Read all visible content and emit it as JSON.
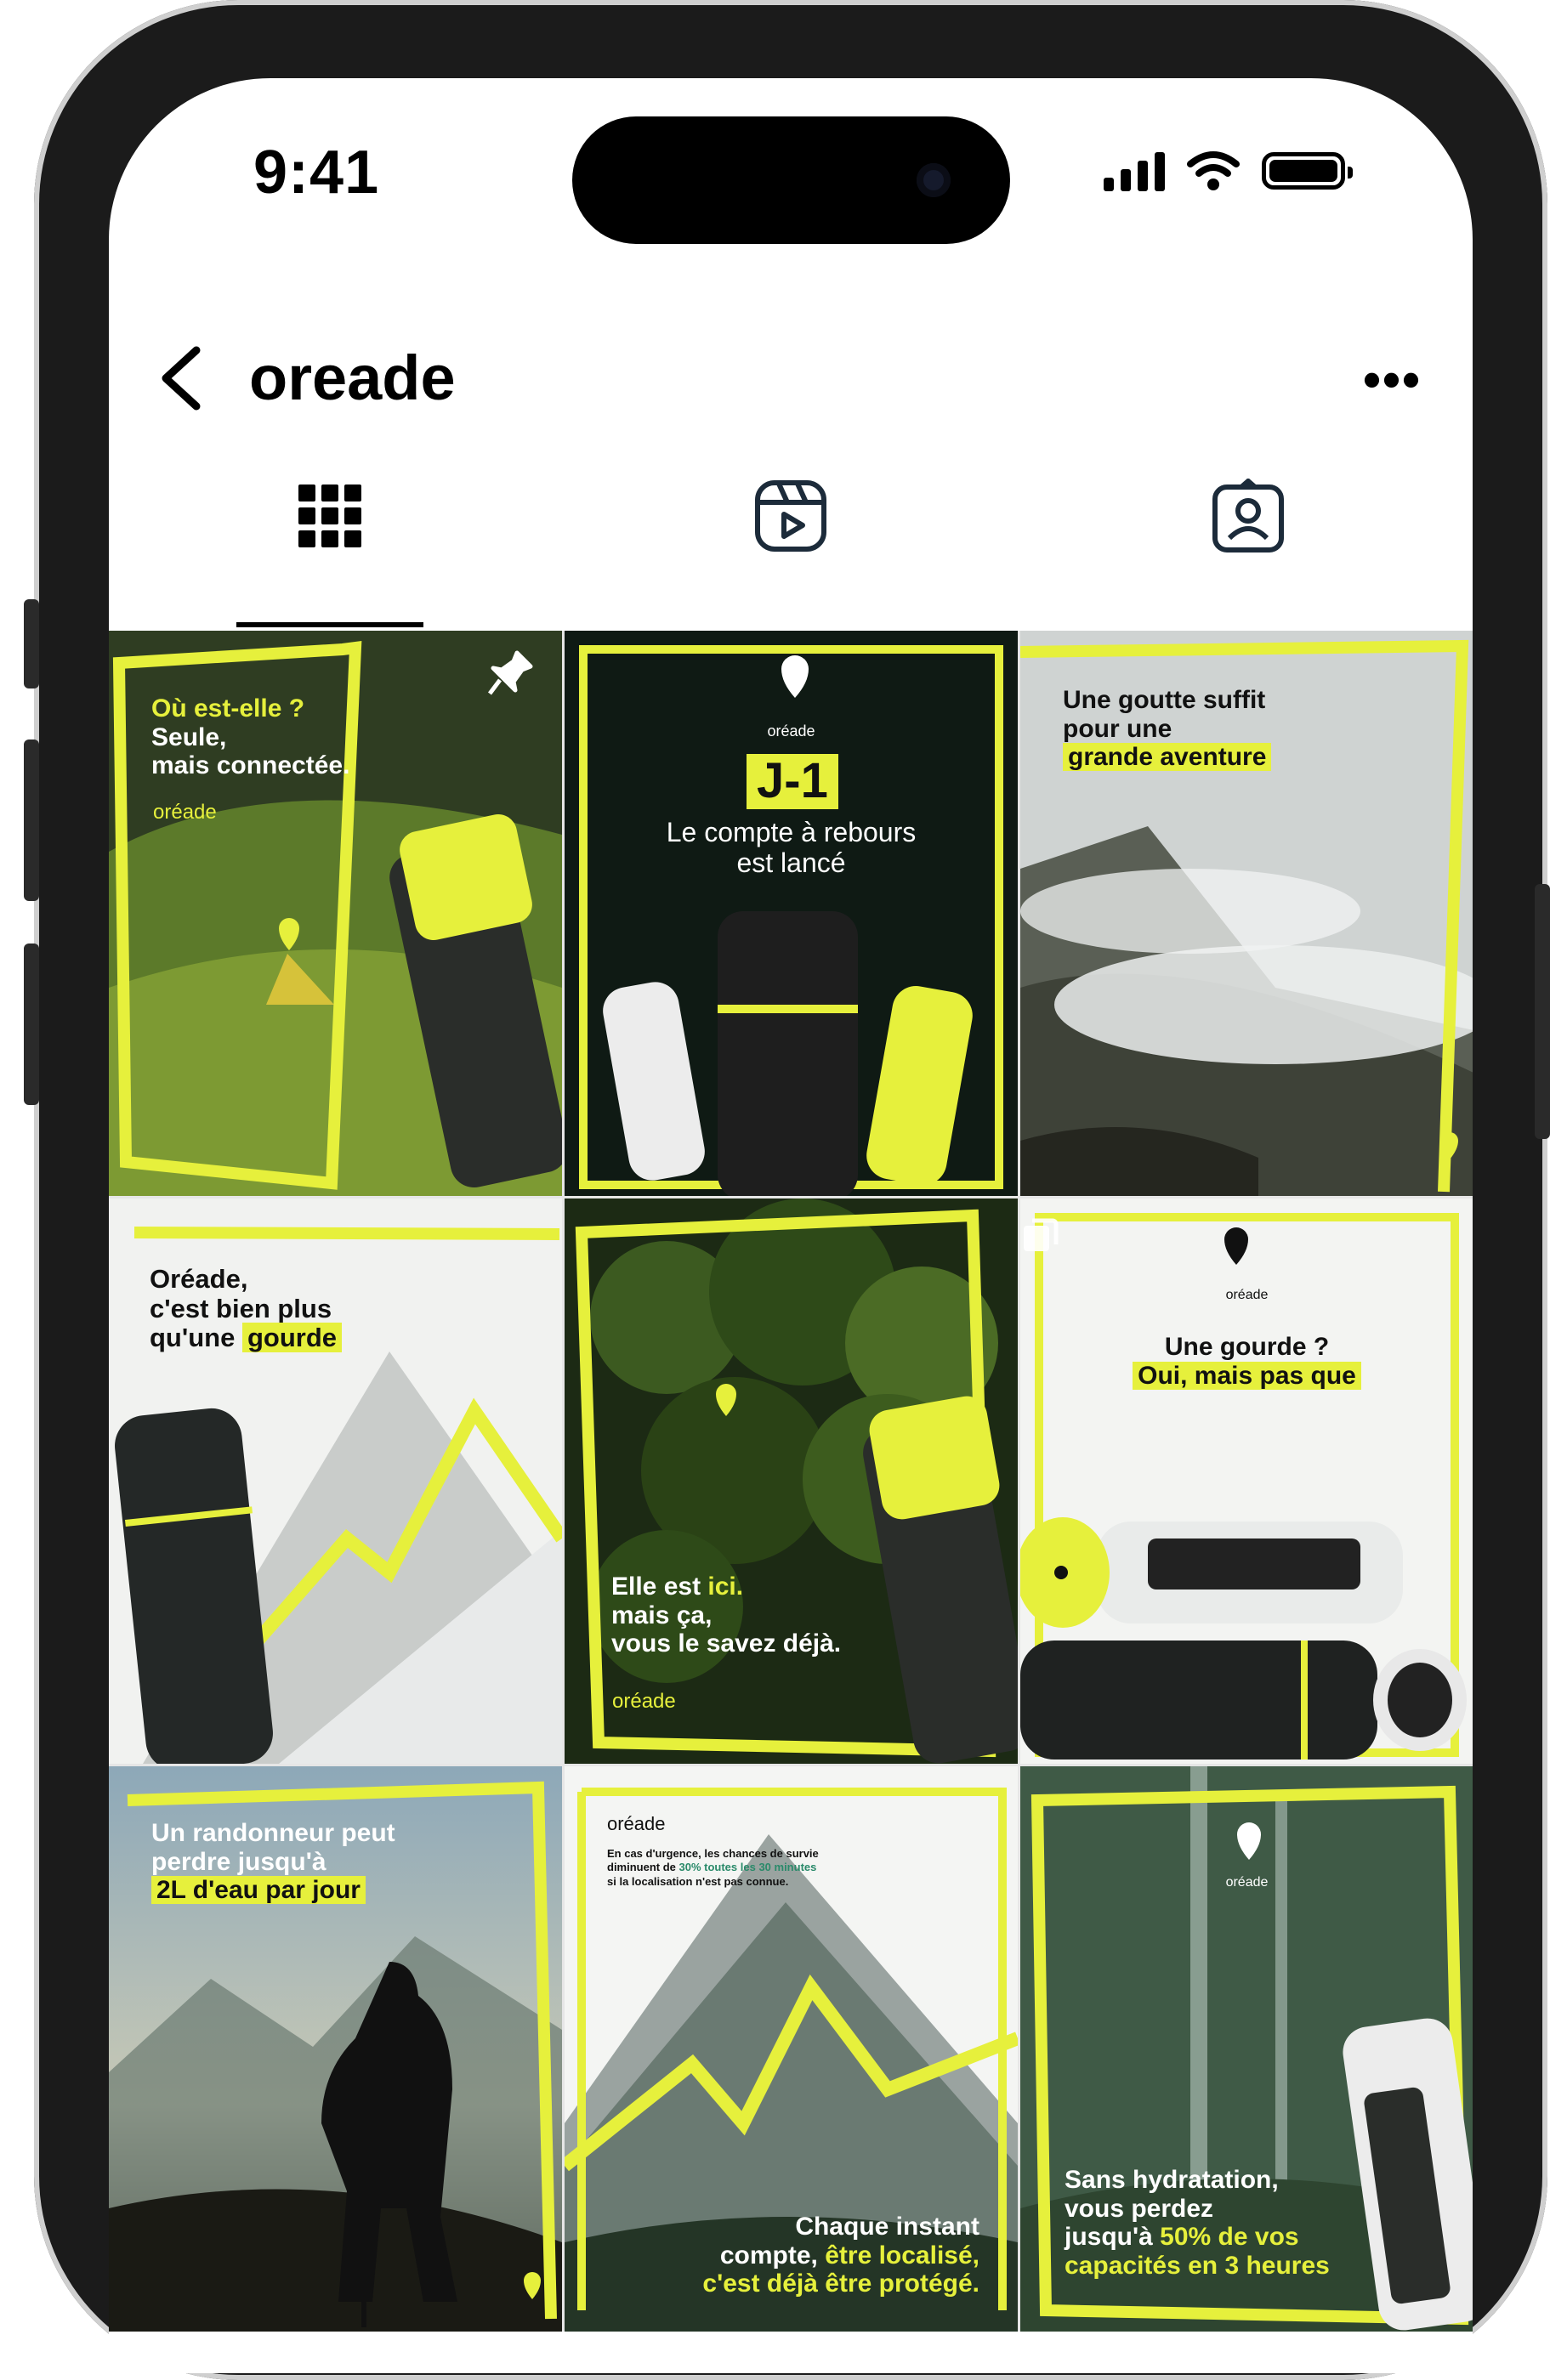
{
  "status_bar": {
    "time": "9:41"
  },
  "header": {
    "username": "oreade",
    "more": "•••"
  },
  "tabs": [
    {
      "name": "posts",
      "icon": "grid-icon"
    },
    {
      "name": "reels",
      "icon": "reels-icon"
    },
    {
      "name": "tagged",
      "icon": "tagged-icon"
    }
  ],
  "colors": {
    "accent": "#e6f03c",
    "dark": "#0f1a14",
    "text": "#000000"
  },
  "posts": [
    {
      "lines": [
        "Où est-elle ?",
        "Seule,",
        "mais connectée."
      ],
      "brand": "oréade"
    },
    {
      "brand": "oréade",
      "badge": "J-1",
      "lines": [
        "Le compte à rebours",
        "est lancé"
      ]
    },
    {
      "lines": [
        "Une goutte suffit",
        "pour une"
      ],
      "highlight": "grande aventure"
    },
    {
      "lines": [
        "Oréade,",
        "c'est bien plus"
      ],
      "prefix": "qu'une",
      "highlight": "gourde"
    },
    {
      "line1_prefix": "Elle est",
      "line1_accent": "ici.",
      "lines": [
        "mais ça,",
        "vous le savez déjà."
      ],
      "brand": "oréade"
    },
    {
      "brand": "oréade",
      "title": "Une gourde ?",
      "highlight": "Oui, mais pas que"
    },
    {
      "lines": [
        "Un randonneur peut",
        "perdre jusqu'à"
      ],
      "highlight": "2L d'eau par jour"
    },
    {
      "brand": "oréade",
      "small_pre": "En cas d'urgence, les chances de survie diminuent de",
      "small_accent": "30% toutes les 30 minutes",
      "small_post": "si la localisation n'est pas connue.",
      "line1": "Chaque instant",
      "line2_prefix": "compte,",
      "line2_accent": "être localisé,",
      "line3": "c'est déjà être protégé."
    },
    {
      "brand": "oréade",
      "lines": [
        "Sans hydratation,",
        "vous perdez"
      ],
      "line3_prefix": "jusqu'à",
      "line3_accent": "50% de vos",
      "line4": "capacités en 3 heures"
    }
  ]
}
